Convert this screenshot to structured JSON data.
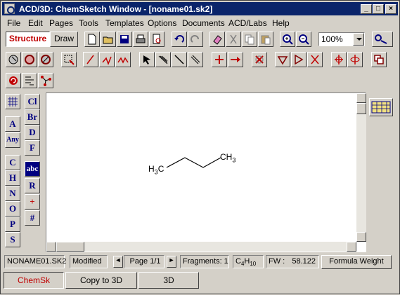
{
  "window": {
    "title": "ACD/3D: ChemSketch Window - [noname01.sk2]",
    "minimize_label": "_",
    "maximize_label": "□",
    "close_label": "×"
  },
  "menu": [
    "File",
    "Edit",
    "Pages",
    "Tools",
    "Templates",
    "Options",
    "Documents",
    "ACD/Labs",
    "Help"
  ],
  "mode_tabs": {
    "structure": "Structure",
    "draw": "Draw"
  },
  "zoom": {
    "value": "100%"
  },
  "element_palette": {
    "left_column": [
      "A",
      "Any",
      "C",
      "H",
      "N",
      "O",
      "P",
      "S"
    ],
    "right_column": [
      "Cl",
      "Br",
      "D",
      "F",
      "abc",
      "R",
      "+",
      "#"
    ]
  },
  "molecule": {
    "name_left": "H3C",
    "name_right": "CH3",
    "left_atom": {
      "main": "H",
      "sub": "3",
      "tail": "C"
    },
    "right_atom": {
      "main": "CH",
      "sub": "3"
    }
  },
  "status": {
    "filename": "NONAME01.SK2",
    "modified": "Modified",
    "page": "Page 1/1",
    "fragments": "Fragments: 1",
    "formula": {
      "c": "C",
      "c_count": "4",
      "h": "H",
      "h_count": "10"
    },
    "fw_label": "FW :",
    "fw_value": "58.122",
    "formula_weight_button": "Formula Weight"
  },
  "bottom_tabs": {
    "chemsk": "ChemSk",
    "copy3d": "Copy to 3D",
    "threed": "3D"
  },
  "colors": {
    "titlebar": "#0a246a",
    "face": "#d4d0c8",
    "accent_red": "#c00000",
    "element_blue": "#000080"
  }
}
